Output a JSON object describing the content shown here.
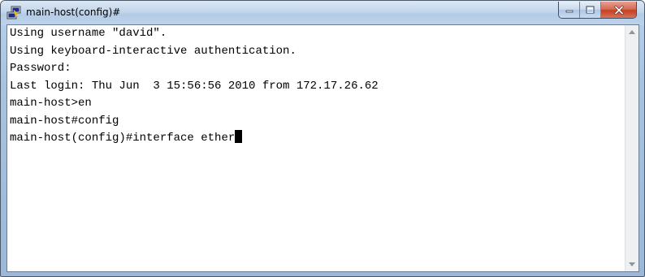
{
  "window": {
    "title": "main-host(config)#",
    "icon": "putty-icon"
  },
  "caption_buttons": {
    "minimize_icon": "minimize-icon",
    "maximize_icon": "maximize-icon",
    "close_icon": "close-icon"
  },
  "terminal": {
    "lines": [
      "Using username \"david\".",
      "Using keyboard-interactive authentication.",
      "Password:",
      "Last login: Thu Jun  3 15:56:56 2010 from 172.17.26.62",
      "main-host>en",
      "main-host#config",
      "main-host(config)#interface ether"
    ]
  },
  "colors": {
    "close_button": "#c3411f",
    "titlebar": "#c3d6ec",
    "terminal_bg": "#ffffff",
    "terminal_fg": "#000000"
  }
}
